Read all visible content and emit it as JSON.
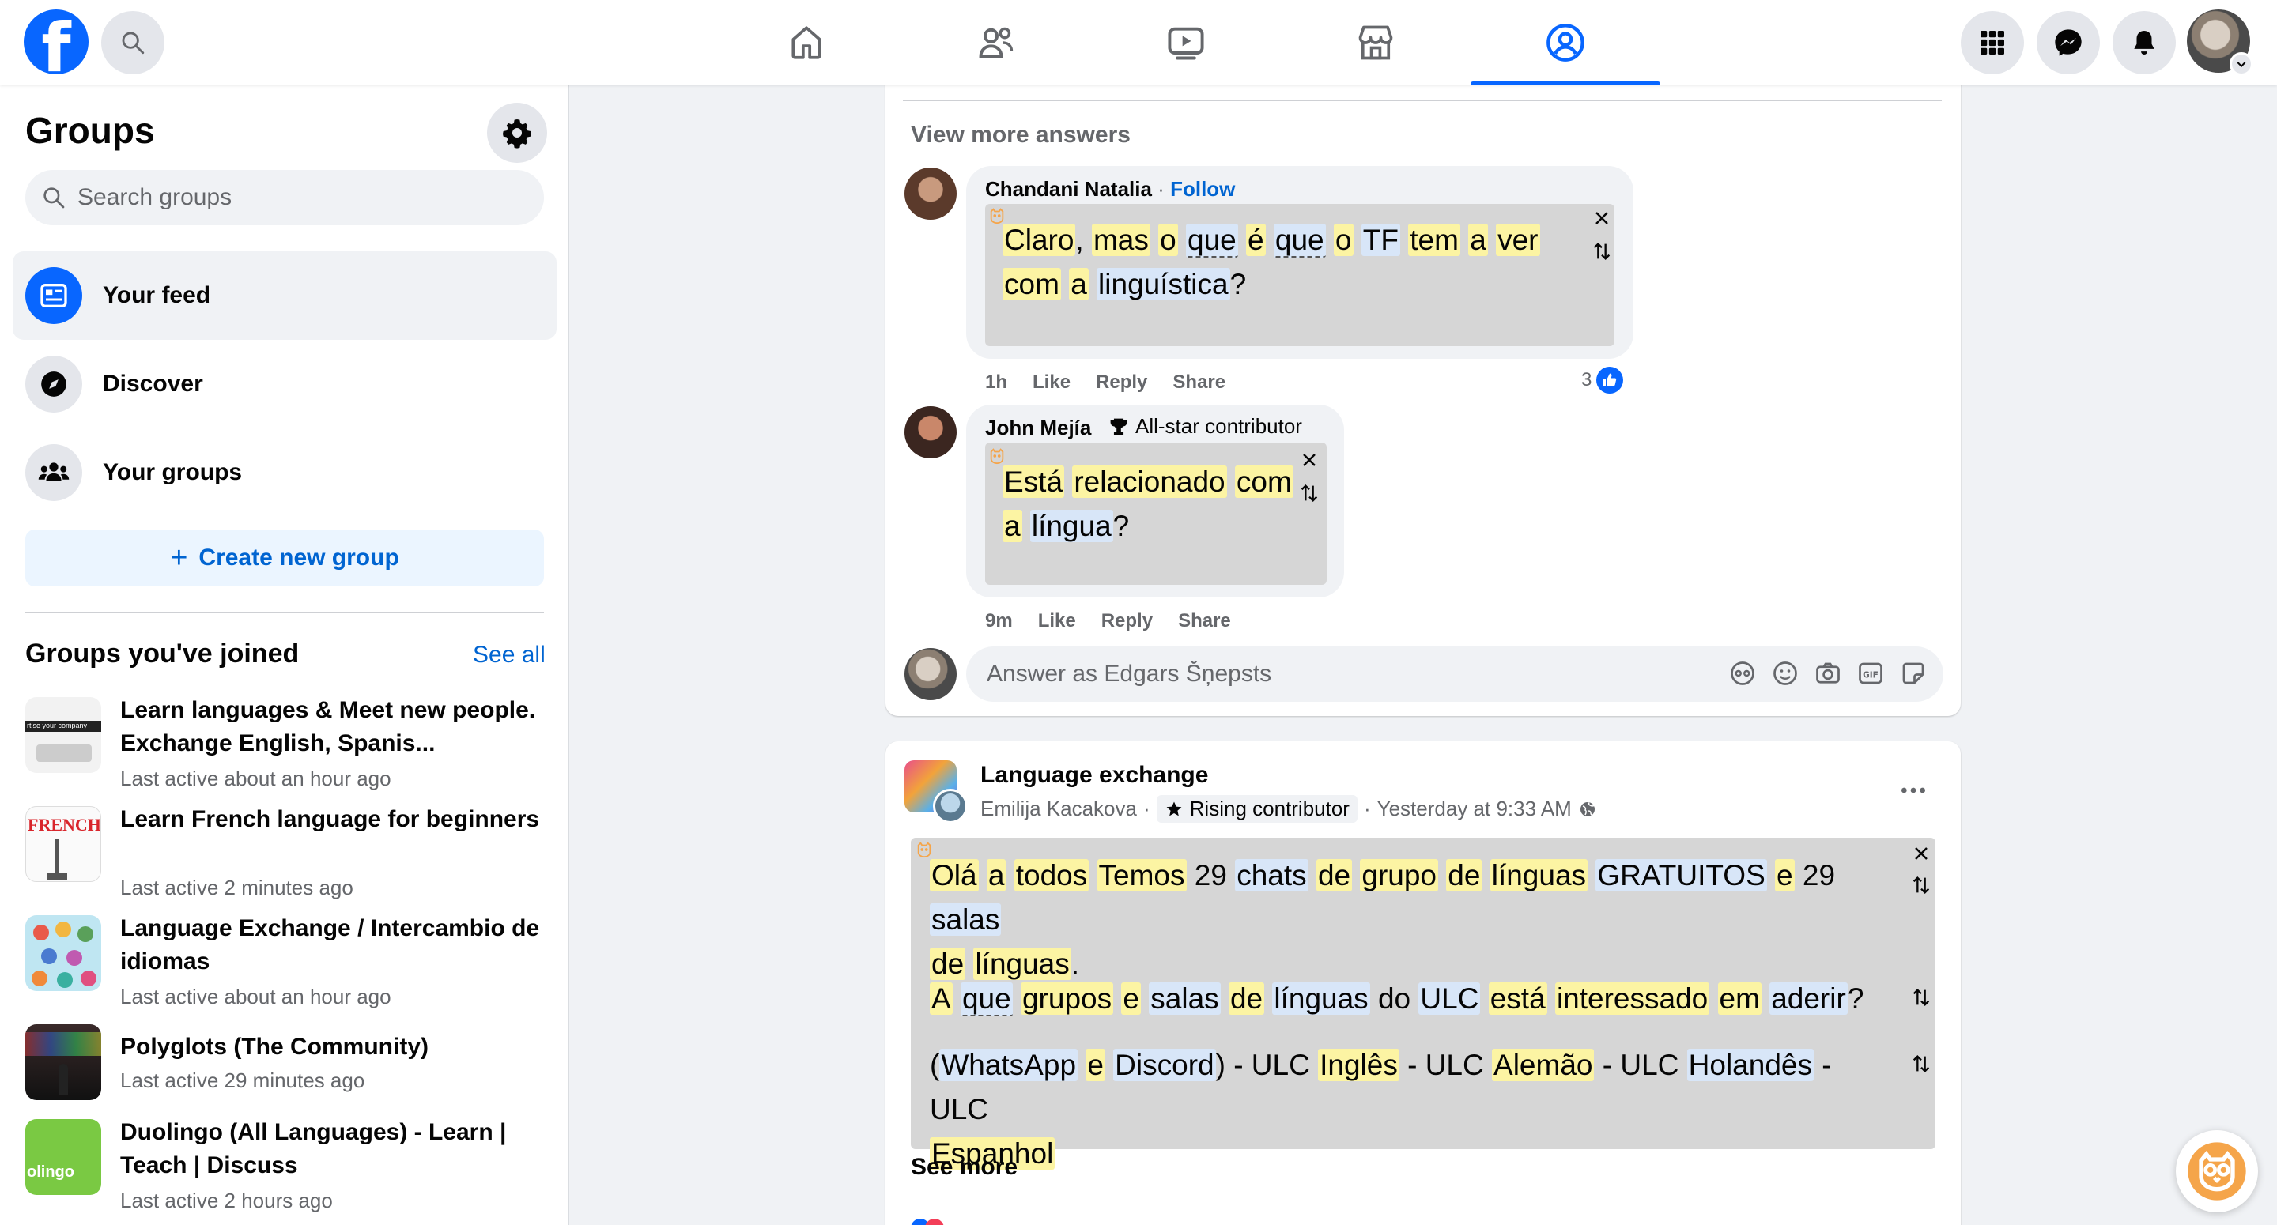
{
  "topbar": {
    "logo_letter": "f",
    "nav_tabs": [
      "home",
      "friends",
      "watch",
      "marketplace",
      "groups"
    ],
    "active_tab": "groups"
  },
  "sidebar": {
    "title": "Groups",
    "search_placeholder": "Search groups",
    "nav": [
      {
        "label": "Your feed",
        "icon": "feed-icon"
      },
      {
        "label": "Discover",
        "icon": "compass-icon"
      },
      {
        "label": "Your groups",
        "icon": "people-group-icon"
      }
    ],
    "create_label": "Create new group",
    "joined_heading": "Groups you've joined",
    "see_all": "See all",
    "groups": [
      {
        "name": "Learn languages & Meet new people. Exchange English, Spanis...",
        "meta": "Last active about an hour ago",
        "thumb_text": "rtise your company"
      },
      {
        "name": "Learn French language for beginners",
        "meta": "Last active 2 minutes ago",
        "thumb_text": "FRENCH"
      },
      {
        "name": "Language Exchange / Intercambio de idiomas",
        "meta": "Last active about an hour ago"
      },
      {
        "name": "Polyglots (The Community)",
        "meta": "Last active 29 minutes ago"
      },
      {
        "name": "Duolingo (All Languages) - Learn | Teach | Discuss",
        "meta": "Last active 2 hours ago",
        "thumb_text": "olingo"
      }
    ]
  },
  "comments_card": {
    "view_more": "View more answers",
    "comments": [
      {
        "author": "Chandani Natalia",
        "separator": "·",
        "follow": "Follow",
        "time": "1h",
        "actions": [
          "Like",
          "Reply",
          "Share"
        ],
        "likes": "3"
      },
      {
        "author": "John Mejía",
        "badge": "All-star contributor",
        "time": "9m",
        "actions": [
          "Like",
          "Reply",
          "Share"
        ]
      }
    ],
    "answer_placeholder": "Answer as Edgars Šņepsts"
  },
  "post_card": {
    "group": "Language exchange",
    "author": "Emilija Kacakova",
    "sep1": "·",
    "badge": "Rising contributor",
    "sep2": "·",
    "time": "Yesterday at 9:33 AM",
    "see_more": "See more"
  },
  "colors": {
    "accent": "#0866ff",
    "highlight_yellow": "#fcf4a3",
    "highlight_blue": "#d8e6f8",
    "translation_box": "#d6d6d6",
    "owl_orange": "#f5a54a"
  }
}
